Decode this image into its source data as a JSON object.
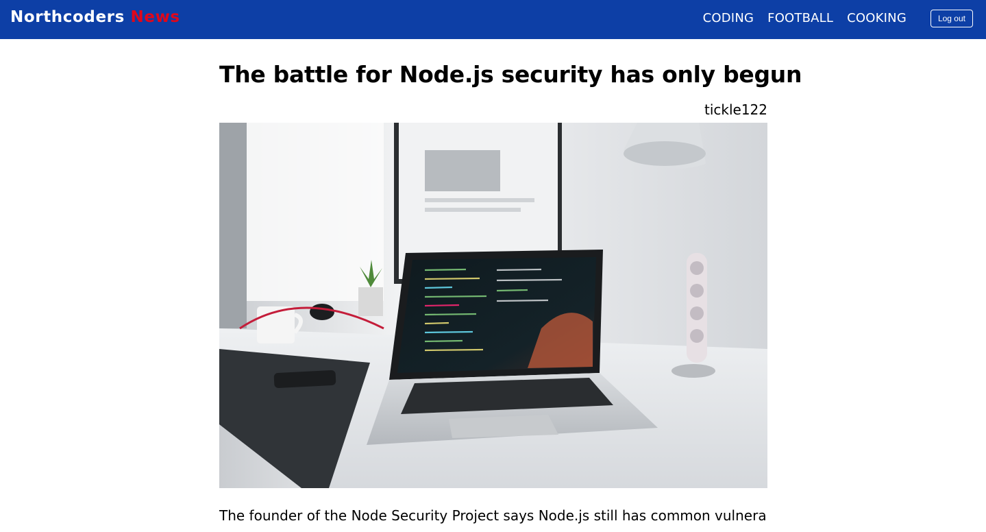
{
  "header": {
    "brand_main": "Northcoders",
    "brand_accent": "News",
    "topics": [
      {
        "label": "CODING"
      },
      {
        "label": "FOOTBALL"
      },
      {
        "label": "COOKING"
      }
    ],
    "logout_label": "Log out"
  },
  "article": {
    "title": "The battle for Node.js security has only begun",
    "author": "tickle122",
    "body_preview": "The founder of the Node Security Project says Node.js still has common vulnerabilities, but"
  },
  "colors": {
    "navbar": "#0d3fa6",
    "brand_accent": "#e0071a"
  }
}
